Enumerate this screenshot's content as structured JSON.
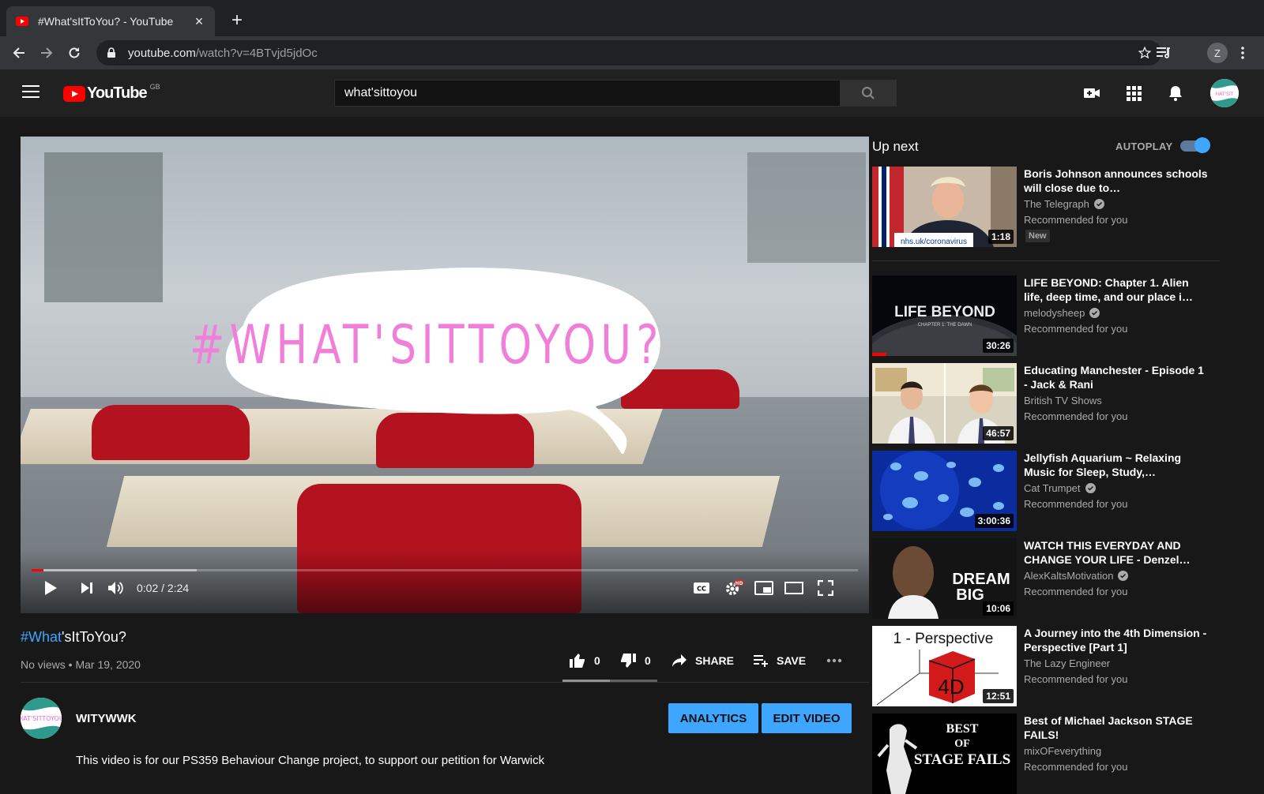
{
  "browser": {
    "tab_title": "#What'sItToYou? - YouTube",
    "url_host": "youtube.com",
    "url_path": "/watch?v=4BTvjd5jdOc",
    "profile_initial": "Z"
  },
  "masthead": {
    "logo_text": "YouTube",
    "region": "GB",
    "search_query": "what'sittoyou"
  },
  "player": {
    "overlay_text": "#WHAT'SITTOYOU?",
    "time": "0:02 / 2:24",
    "progress_fraction": 0.014,
    "buffered_fraction": 0.2,
    "colors": {
      "progress": "#ff0000",
      "overlay_text": "#f07fda"
    }
  },
  "video": {
    "title_hash": "#What",
    "title_rest": "'sItToYou?",
    "meta": "No views • Mar 19, 2020",
    "likes": "0",
    "dislikes": "0",
    "share_label": "SHARE",
    "save_label": "SAVE"
  },
  "channel": {
    "name": "WITYWWK",
    "avatar_text": "HAT'SITTOYOU",
    "analytics_label": "ANALYTICS",
    "edit_label": "EDIT VIDEO",
    "description": "This video is for our PS359 Behaviour Change project, to support our petition for Warwick"
  },
  "sidebar": {
    "up_next": "Up next",
    "autoplay": "AUTOPLAY",
    "autoplay_on": true,
    "items": [
      {
        "title": "Boris Johnson announces schools will close due to…",
        "channel": "The Telegraph",
        "verified": true,
        "rec": "Recommended for you",
        "duration": "1:18",
        "badge": "New",
        "thumb_caption": "nhs.uk/coronavirus"
      },
      {
        "title": "LIFE BEYOND: Chapter 1. Alien life, deep time, and our place i…",
        "channel": "melodysheep",
        "verified": true,
        "rec": "Recommended for you",
        "duration": "30:26",
        "thumb_caption": "LIFE BEYOND",
        "thumb_sub": "CHAPTER 1: THE DAWN",
        "watched_fraction": 0.1
      },
      {
        "title": "Educating Manchester - Episode 1 - Jack & Rani",
        "channel": "British TV Shows",
        "verified": false,
        "rec": "Recommended for you",
        "duration": "46:57"
      },
      {
        "title": "Jellyfish Aquarium ~ Relaxing Music for Sleep, Study,…",
        "channel": "Cat Trumpet",
        "verified": true,
        "rec": "Recommended for you",
        "duration": "3:00:36"
      },
      {
        "title": "WATCH THIS EVERYDAY AND CHANGE YOUR LIFE - Denzel…",
        "channel": "AlexKaltsMotivation",
        "verified": true,
        "rec": "Recommended for you",
        "duration": "10:06",
        "thumb_caption": "DREAM",
        "thumb_sub": "BIG"
      },
      {
        "title": "A Journey into the 4th Dimension - Perspective [Part 1]",
        "channel": "The Lazy Engineer",
        "verified": false,
        "rec": "Recommended for you",
        "duration": "12:51",
        "thumb_caption": "1  -  Perspective",
        "thumb_sub": "4D"
      },
      {
        "title": "Best of Michael Jackson STAGE FAILS!",
        "channel": "mixOFeverything",
        "verified": false,
        "rec": "Recommended for you",
        "thumb_caption": "BEST",
        "thumb_sub": "OF",
        "thumb_sub2": "STAGE FAILS"
      }
    ]
  }
}
